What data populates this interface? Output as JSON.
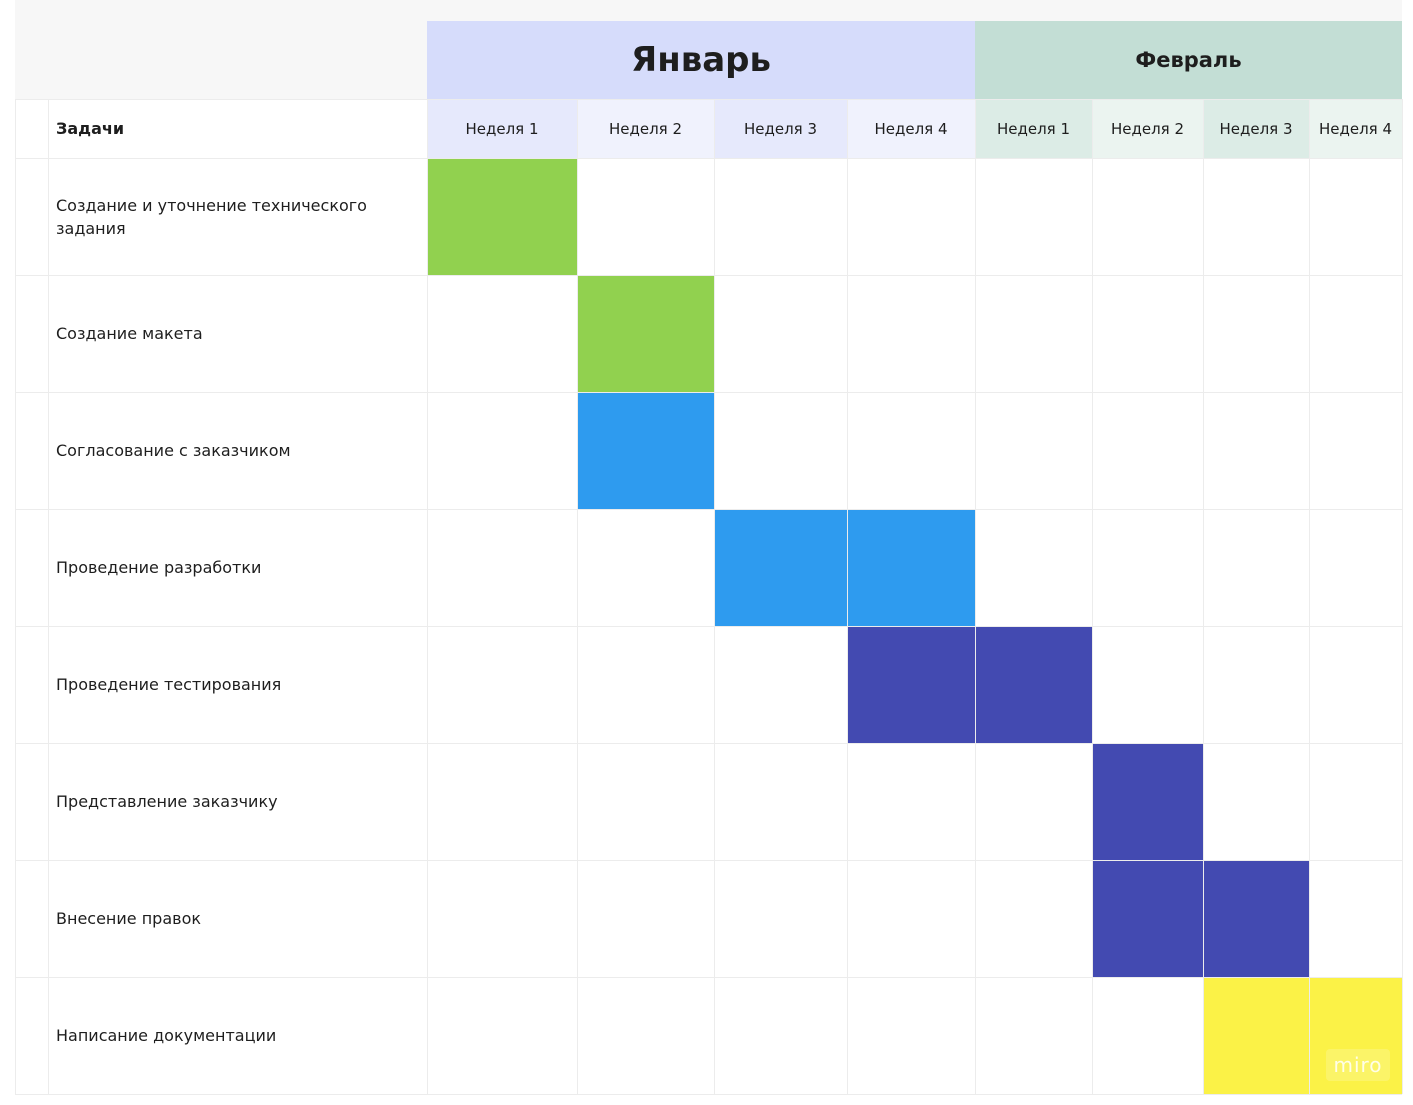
{
  "months": [
    {
      "label": "Январь",
      "bg": "#d6dcfb",
      "weeks_bg": [
        "#e6e9fc",
        "#f0f2fd",
        "#e6e9fc",
        "#f0f2fd"
      ]
    },
    {
      "label": "Февраль",
      "bg": "#c3ded5",
      "weeks_bg": [
        "#dcece6",
        "#ebf4f0",
        "#dcece6",
        "#ebf4f0"
      ]
    }
  ],
  "header": {
    "tasks_label": "Задачи"
  },
  "weeks": [
    "Неделя 1",
    "Неделя 2",
    "Неделя 3",
    "Неделя 4",
    "Неделя 1",
    "Неделя 2",
    "Неделя 3",
    "Неделя 4"
  ],
  "tasks": [
    {
      "label": "Создание и уточнение технического задания",
      "weeks": [
        0
      ],
      "color": "#91d14f"
    },
    {
      "label": "Создание макета",
      "weeks": [
        1
      ],
      "color": "#91d14f"
    },
    {
      "label": "Согласование с заказчиком",
      "weeks": [
        1
      ],
      "color": "#2e9bef"
    },
    {
      "label": "Проведение разработки",
      "weeks": [
        2,
        3
      ],
      "color": "#2e9bef"
    },
    {
      "label": "Проведение тестирования",
      "weeks": [
        3,
        4
      ],
      "color": "#434ab1"
    },
    {
      "label": "Представление заказчику",
      "weeks": [
        5
      ],
      "color": "#434ab1"
    },
    {
      "label": "Внесение правок",
      "weeks": [
        5,
        6
      ],
      "color": "#434ab1"
    },
    {
      "label": "Написание документации",
      "weeks": [
        6,
        7
      ],
      "color": "#fbf247"
    }
  ],
  "watermark": "miro"
}
